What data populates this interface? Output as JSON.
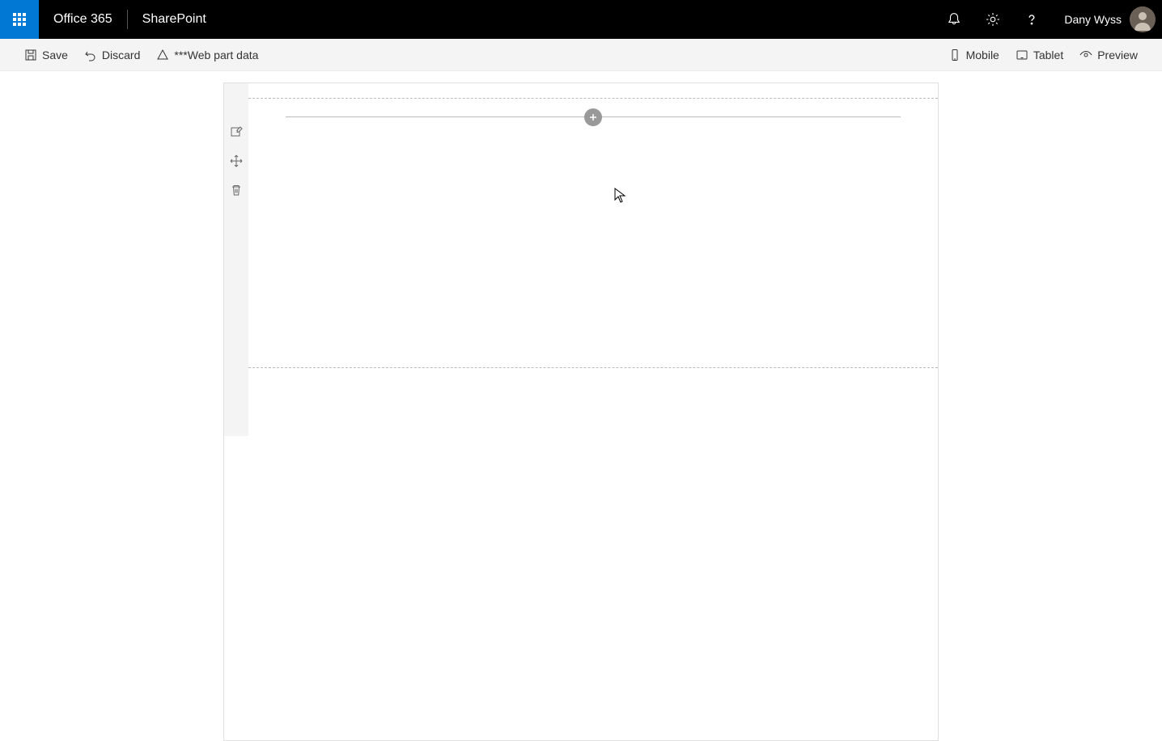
{
  "header": {
    "office365_label": "Office 365",
    "sharepoint_label": "SharePoint",
    "user_name": "Dany Wyss"
  },
  "command_bar": {
    "save_label": "Save",
    "discard_label": "Discard",
    "webpartdata_label": "***Web part data",
    "mobile_label": "Mobile",
    "tablet_label": "Tablet",
    "preview_label": "Preview"
  }
}
